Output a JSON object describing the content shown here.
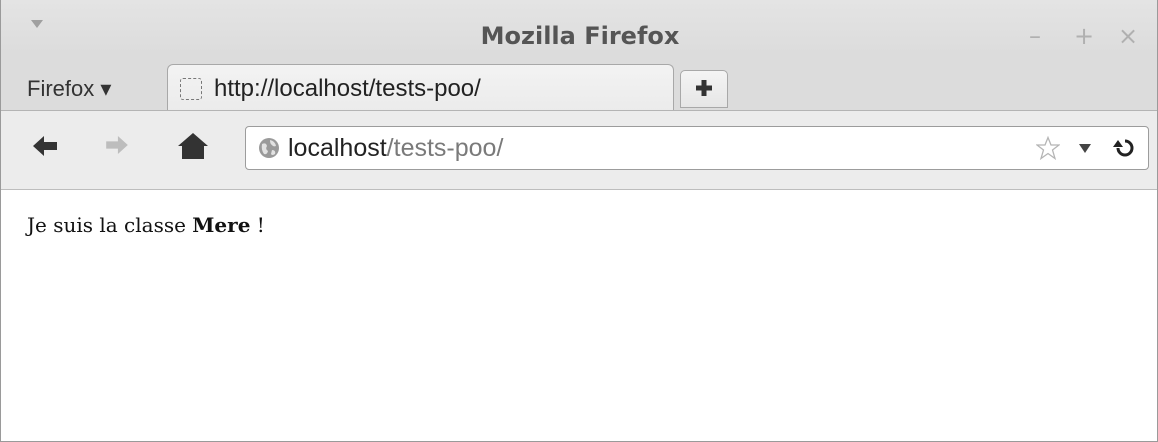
{
  "window": {
    "title": "Mozilla Firefox",
    "controls": {
      "minimize": "–",
      "maximize": "+",
      "close": "×"
    }
  },
  "tabstrip": {
    "firefox_menu_label": "Firefox ▾",
    "tabs": [
      {
        "label": "http://localhost/tests-poo/"
      }
    ],
    "new_tab_icon": "plus-icon"
  },
  "navbar": {
    "back_icon": "back-arrow-icon",
    "forward_icon": "forward-arrow-icon",
    "home_icon": "home-icon",
    "url_host": "localhost",
    "url_path": "/tests-poo/",
    "bookmark_icon": "star-icon",
    "reload_icon": "reload-icon"
  },
  "page": {
    "text_before": "Je suis la classe ",
    "text_bold": "Mere",
    "text_after": " !"
  }
}
